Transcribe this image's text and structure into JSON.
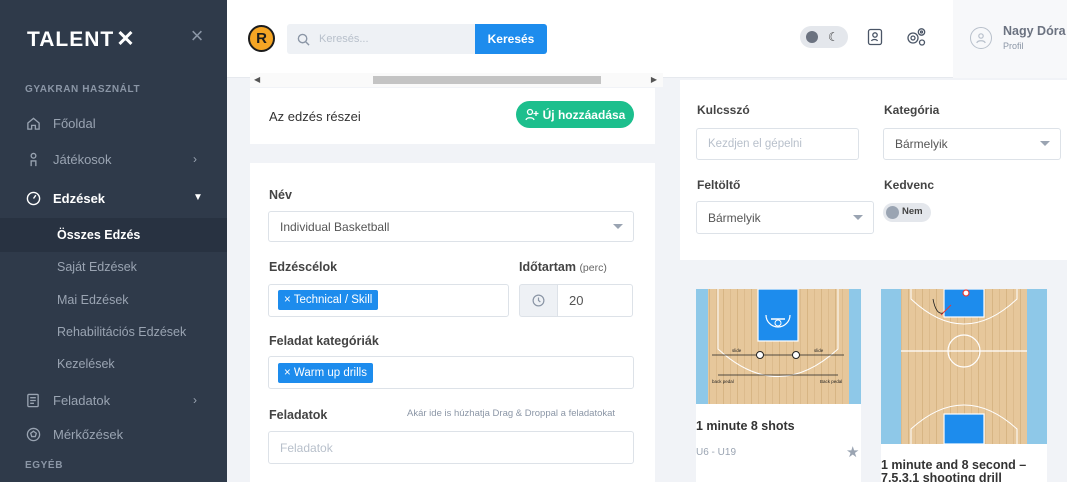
{
  "sidebar": {
    "brand": "TALENT",
    "brand_mark": "✕",
    "section_frequent": "GYAKRAN HASZNÁLT",
    "section_other": "EGYÉB",
    "items": [
      {
        "label": "Főoldal"
      },
      {
        "label": "Játékosok"
      },
      {
        "label": "Edzések"
      },
      {
        "label": "Feladatok"
      },
      {
        "label": "Mérkőzések"
      }
    ],
    "sub_items": [
      {
        "label": "Összes Edzés"
      },
      {
        "label": "Saját Edzések"
      },
      {
        "label": "Mai Edzések"
      },
      {
        "label": "Rehabilitációs Edzések"
      },
      {
        "label": "Kezelések"
      }
    ]
  },
  "topbar": {
    "logo_letter": "R",
    "search_placeholder": "Keresés...",
    "search_button": "Keresés",
    "user_name": "Nagy Dóra",
    "user_role": "Profil"
  },
  "form": {
    "section_title": "Az edzés részei",
    "new_button": "Új hozzáadása",
    "name_label": "Név",
    "name_value": "Individual Basketball",
    "goals_label": "Edzéscélok",
    "goals_tag": "× Technical / Skill",
    "duration_label": "Időtartam",
    "duration_unit": "(perc)",
    "duration_value": "20",
    "task_cat_label": "Feladat kategóriák",
    "task_cat_tag": "× Warm up drills",
    "tasks_label": "Feladatok",
    "tasks_hint": "Akár ide is húzhatja Drag & Droppal a feladatokat",
    "tasks_placeholder": "Feladatok"
  },
  "filters": {
    "keyword_label": "Kulcsszó",
    "keyword_placeholder": "Kezdjen el gépelni",
    "category_label": "Kategória",
    "category_value": "Bármelyik",
    "uploader_label": "Feltöltő",
    "uploader_value": "Bármelyik",
    "favorite_label": "Kedvenc",
    "favorite_value": "Nem"
  },
  "cards": [
    {
      "title": "1 minute 8 shots",
      "subtitle": "U6 - U19",
      "court_labels": [
        "slide",
        "slide",
        "back pedal",
        "Back pedal"
      ]
    },
    {
      "title": "1 minute and 8 second – 7,5,3,1 shooting drill",
      "subtitle": ""
    }
  ],
  "colors": {
    "sidebar": "#2f3a4a",
    "accent_blue": "#1d8ced",
    "accent_green": "#1cbf8d"
  }
}
